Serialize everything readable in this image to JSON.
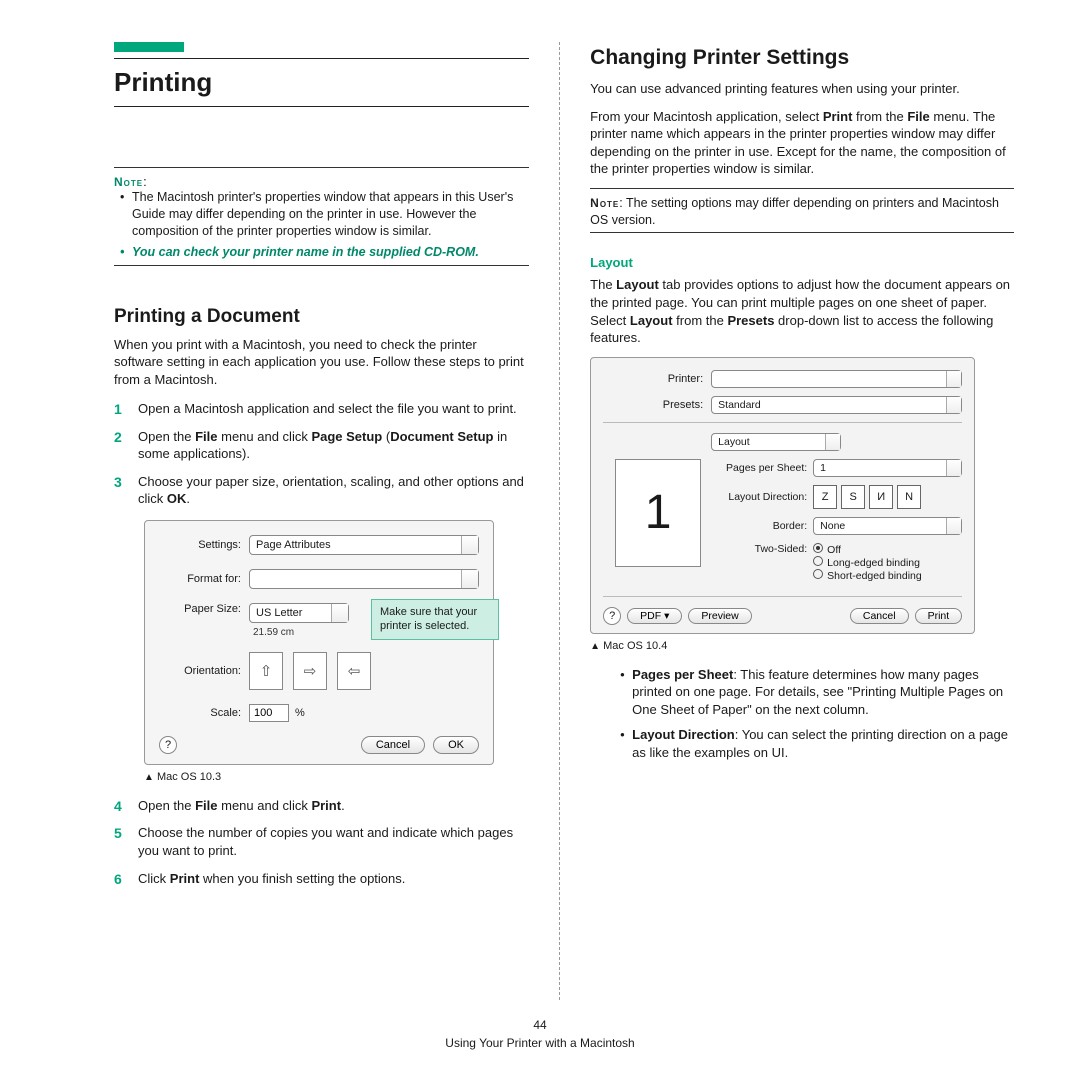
{
  "left": {
    "title": "Printing",
    "note_label": "Note",
    "note_bullets": [
      "The Macintosh printer's properties window that appears in this User's Guide may differ depending on the printer in use. However the composition of the printer properties window is similar.",
      "You can check your printer name in the supplied CD-ROM."
    ],
    "section_title": "Printing a Document",
    "section_intro": "When you print with a Macintosh, you need to check the printer software setting in each application you use. Follow these steps to print from a Macintosh.",
    "steps": [
      {
        "text": "Open a Macintosh application and select the file you want to print."
      },
      {
        "text_html": "Open the <b>File</b> menu and click <b>Page Setup</b> (<b>Document Setup</b> in some applications)."
      },
      {
        "text_html": "Choose your paper size, orientation, scaling, and other options and click <b>OK</b>."
      }
    ],
    "dialog": {
      "settings_label": "Settings:",
      "settings_value": "Page Attributes",
      "format_for_label": "Format for:",
      "format_for_value": "",
      "paper_size_label": "Paper Size:",
      "paper_size_value": "US Letter",
      "paper_dim": "21.59 cm",
      "orientation_label": "Orientation:",
      "scale_label": "Scale:",
      "scale_value": "100",
      "scale_suffix": "%",
      "cancel": "Cancel",
      "ok": "OK",
      "callout": "Make sure that your printer is selected."
    },
    "caption": "Mac OS 10.3",
    "steps2": [
      {
        "text_html": "Open the <b>File</b> menu and click <b>Print</b>."
      },
      {
        "text": "Choose the number of copies you want and indicate which pages you want to print."
      },
      {
        "text_html": "Click <b>Print</b> when you finish setting the options."
      }
    ]
  },
  "right": {
    "title": "Changing Printer Settings",
    "intro1": "You can use advanced printing features when using your printer.",
    "intro2_html": "From your Macintosh application, select <b>Print</b> from the <b>File</b> menu. The printer name which appears in the printer properties window may differ depending on the printer in use. Except for the name, the composition of the printer properties window is similar.",
    "note_label": "Note",
    "note_text": ": The setting options may differ depending on printers and Macintosh OS version.",
    "layout_head": "Layout",
    "layout_body_html": "The <b>Layout</b> tab provides options to adjust how the document appears on the printed page. You can print multiple pages on one sheet of paper. Select <b>Layout</b> from the <b>Presets</b> drop-down list to access the following features.",
    "dialog": {
      "printer_label": "Printer:",
      "printer_value": "",
      "presets_label": "Presets:",
      "presets_value": "Standard",
      "panel_value": "Layout",
      "pps_label": "Pages per Sheet:",
      "pps_value": "1",
      "dir_label": "Layout Direction:",
      "border_label": "Border:",
      "border_value": "None",
      "two_sided_label": "Two-Sided:",
      "opt_off": "Off",
      "opt_long": "Long-edged binding",
      "opt_short": "Short-edged binding",
      "help": "?",
      "pdf": "PDF ▾",
      "preview": "Preview",
      "cancel": "Cancel",
      "print": "Print"
    },
    "caption": "Mac OS 10.4",
    "bullets": [
      {
        "html": "<b>Pages per Sheet</b>: This feature determines how many pages printed on one page. For details, see \"Printing Multiple Pages on One Sheet of Paper\" on the next column."
      },
      {
        "html": "<b>Layout Direction</b>: You can select the printing direction on a page as like the examples on UI."
      }
    ]
  },
  "footer": {
    "page_no": "44",
    "running": "Using Your Printer with a Macintosh"
  }
}
